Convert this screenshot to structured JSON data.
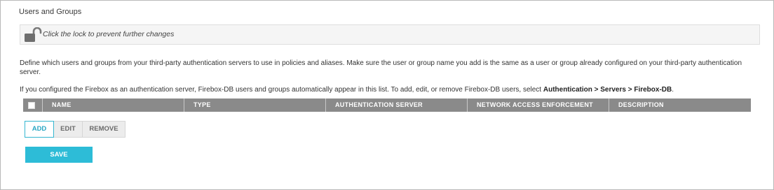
{
  "page": {
    "title": "Users and Groups"
  },
  "lock": {
    "text": "Click the lock to prevent further changes",
    "icon": "unlocked-padlock-icon"
  },
  "description": {
    "paragraph1": "Define which users and groups from your third-party authentication servers to use in policies and aliases. Make sure the user or group name you add is the same as a user or group already configured on your third-party authentication server.",
    "paragraph2_prefix": "If you configured the Firebox as an authentication server, Firebox-DB users and groups automatically appear in this list. To add, edit, or remove Firebox-DB users, select ",
    "paragraph2_bold": "Authentication > Servers > Firebox-DB",
    "paragraph2_suffix": "."
  },
  "table": {
    "columns": [
      "NAME",
      "TYPE",
      "AUTHENTICATION SERVER",
      "NETWORK ACCESS ENFORCEMENT",
      "DESCRIPTION"
    ],
    "rows": []
  },
  "buttons": {
    "add": "ADD",
    "edit": "EDIT",
    "remove": "REMOVE",
    "save": "SAVE"
  },
  "colors": {
    "accent": "#2dbcd7",
    "header_bg": "#8a8a8a",
    "lock_bar_bg": "#f5f5f5",
    "button_gray": "#ececec"
  }
}
